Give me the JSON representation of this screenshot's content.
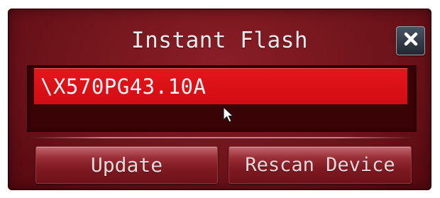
{
  "dialog": {
    "title": "Instant Flash",
    "close_icon": "close-x-icon"
  },
  "file_list": {
    "selected_file": "\\X570PG43.10A"
  },
  "actions": {
    "update_label": "Update",
    "rescan_label": "Rescan Device"
  },
  "colors": {
    "dialog_background": "#6f141b",
    "selection_highlight": "#e4161c",
    "button_face": "#9a2e36",
    "close_button": "#2f3541",
    "text": "#ececec"
  },
  "icons": {
    "cursor": "mouse-pointer-icon"
  }
}
